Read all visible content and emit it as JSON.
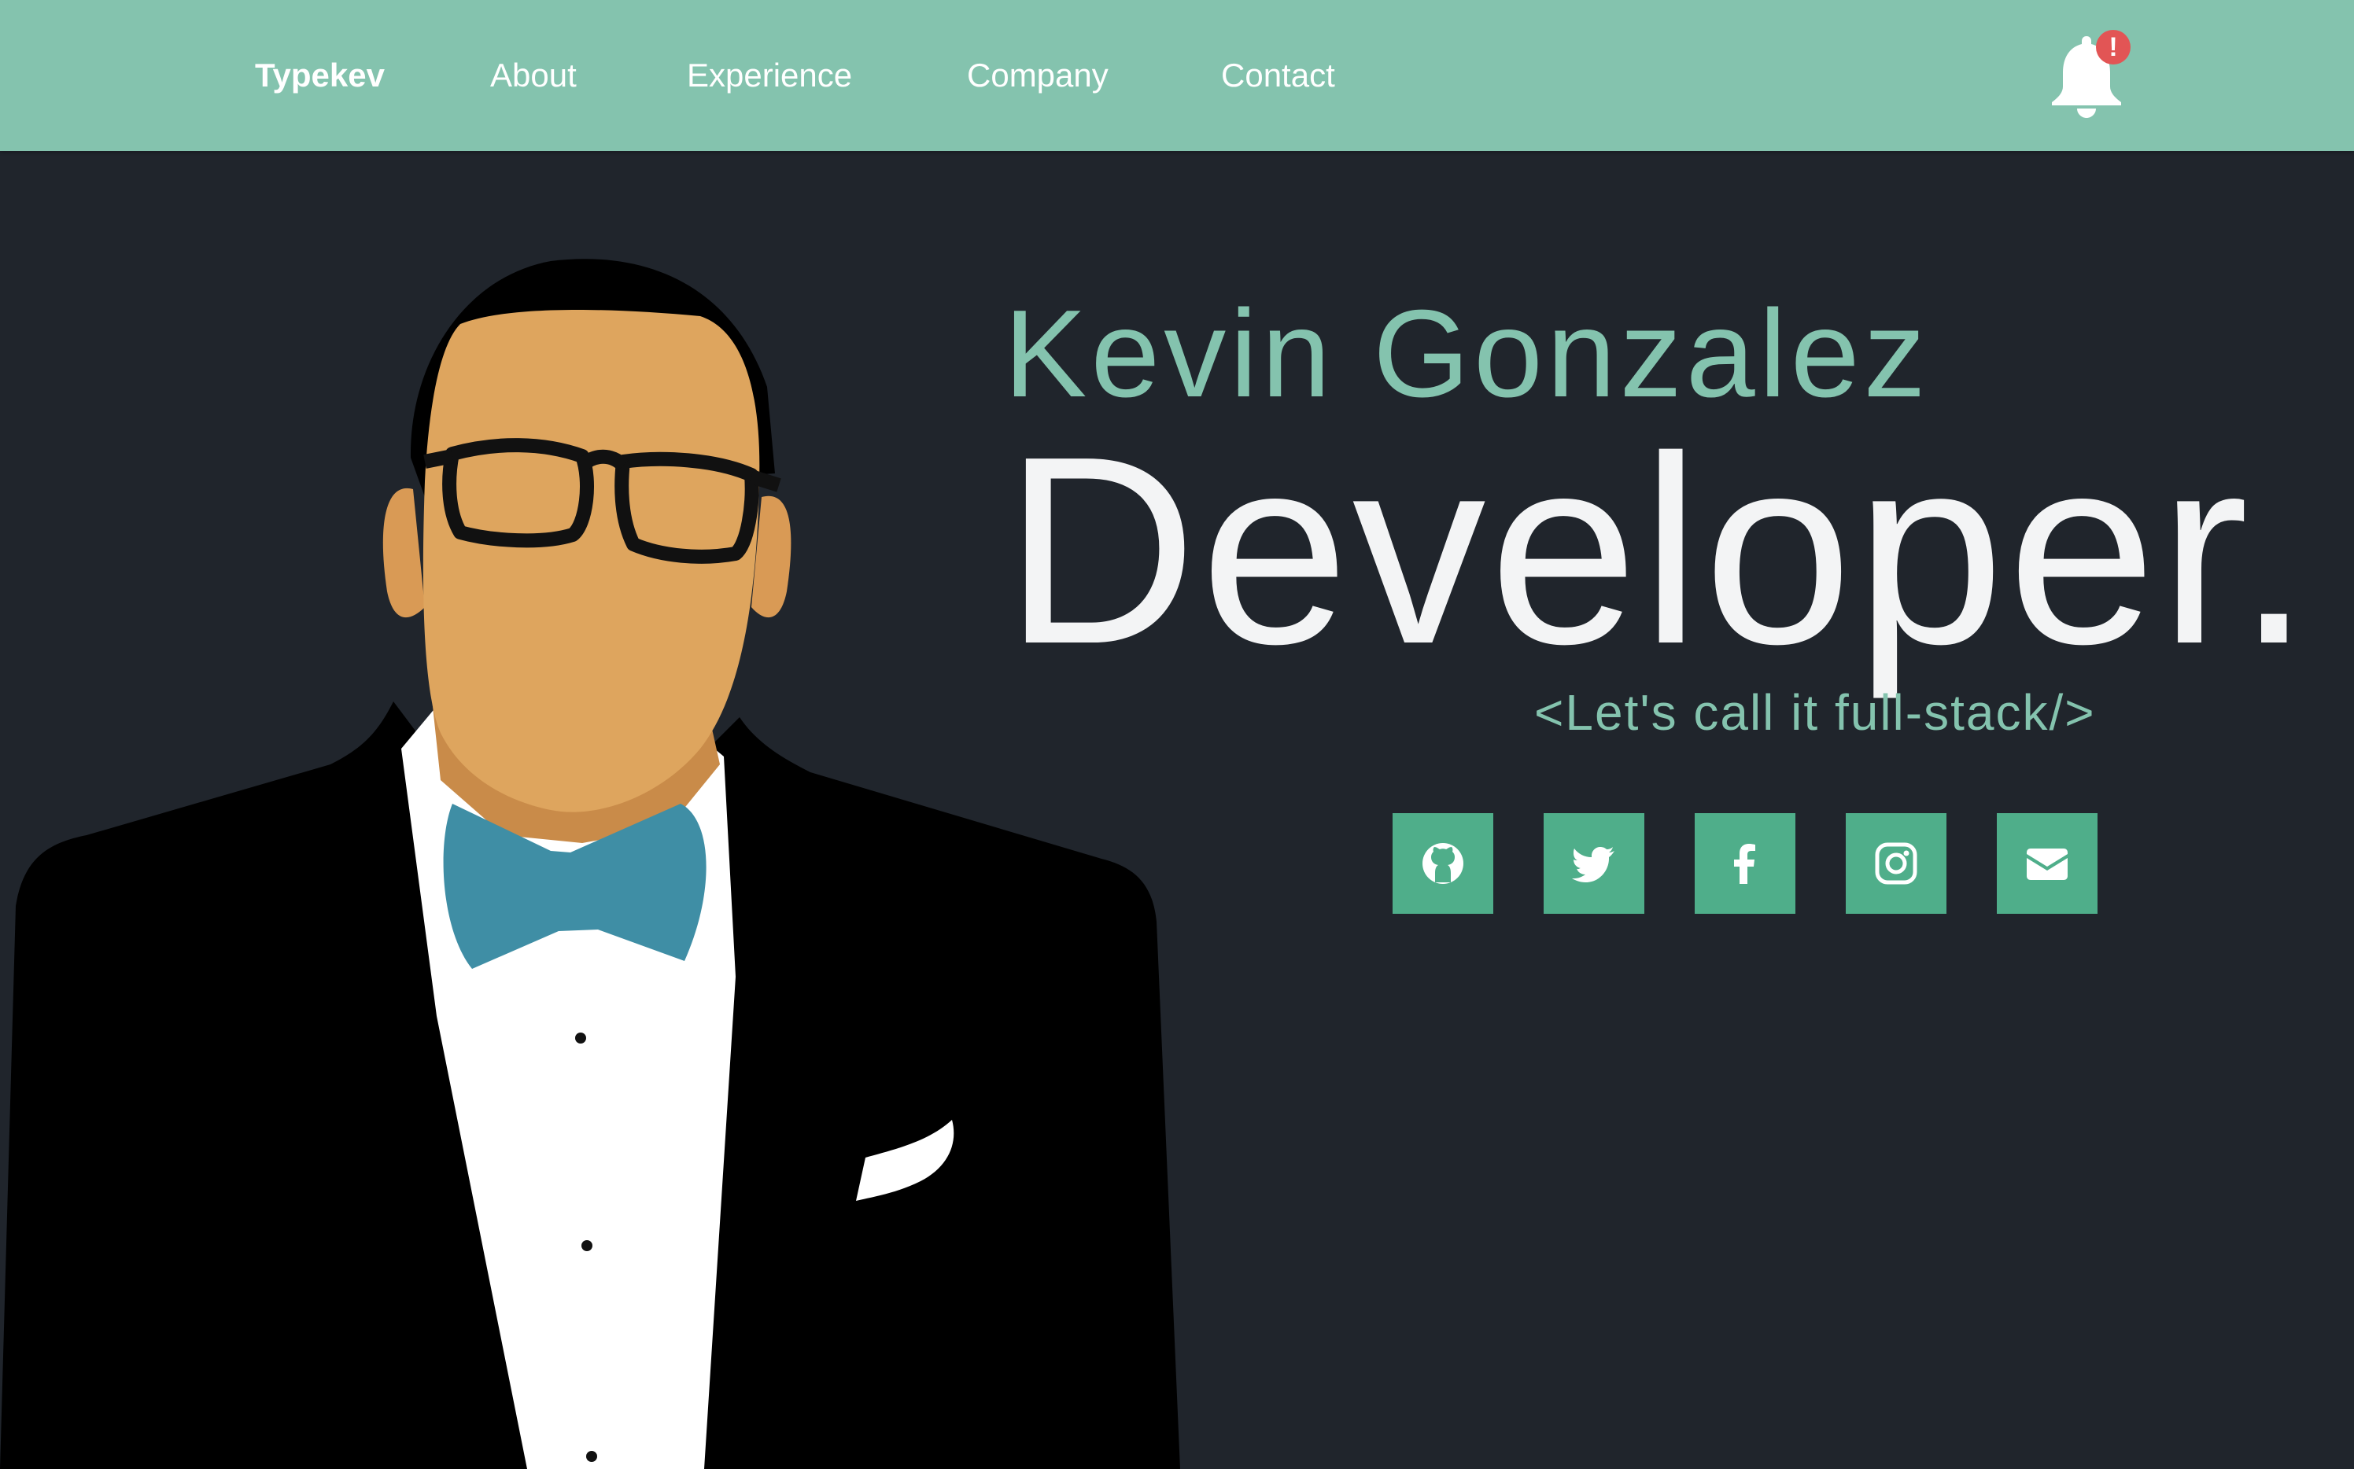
{
  "nav": {
    "brand": "Typekev",
    "links": [
      "About",
      "Experience",
      "Company",
      "Contact"
    ],
    "notification_badge": "!",
    "notification_icon": "bell-icon"
  },
  "hero": {
    "name": "Kevin Gonzalez",
    "title": "Developer.",
    "tagline": "<Let's call it full-stack/>"
  },
  "social": [
    {
      "icon": "github-icon"
    },
    {
      "icon": "twitter-icon"
    },
    {
      "icon": "facebook-icon"
    },
    {
      "icon": "instagram-icon"
    },
    {
      "icon": "mail-icon"
    }
  ],
  "colors": {
    "navbar": "#84c3ae",
    "background": "#20252c",
    "accent": "#84c3ae",
    "social_button": "#4fae8a",
    "badge": "#e25555",
    "title": "#f3f4f5"
  }
}
